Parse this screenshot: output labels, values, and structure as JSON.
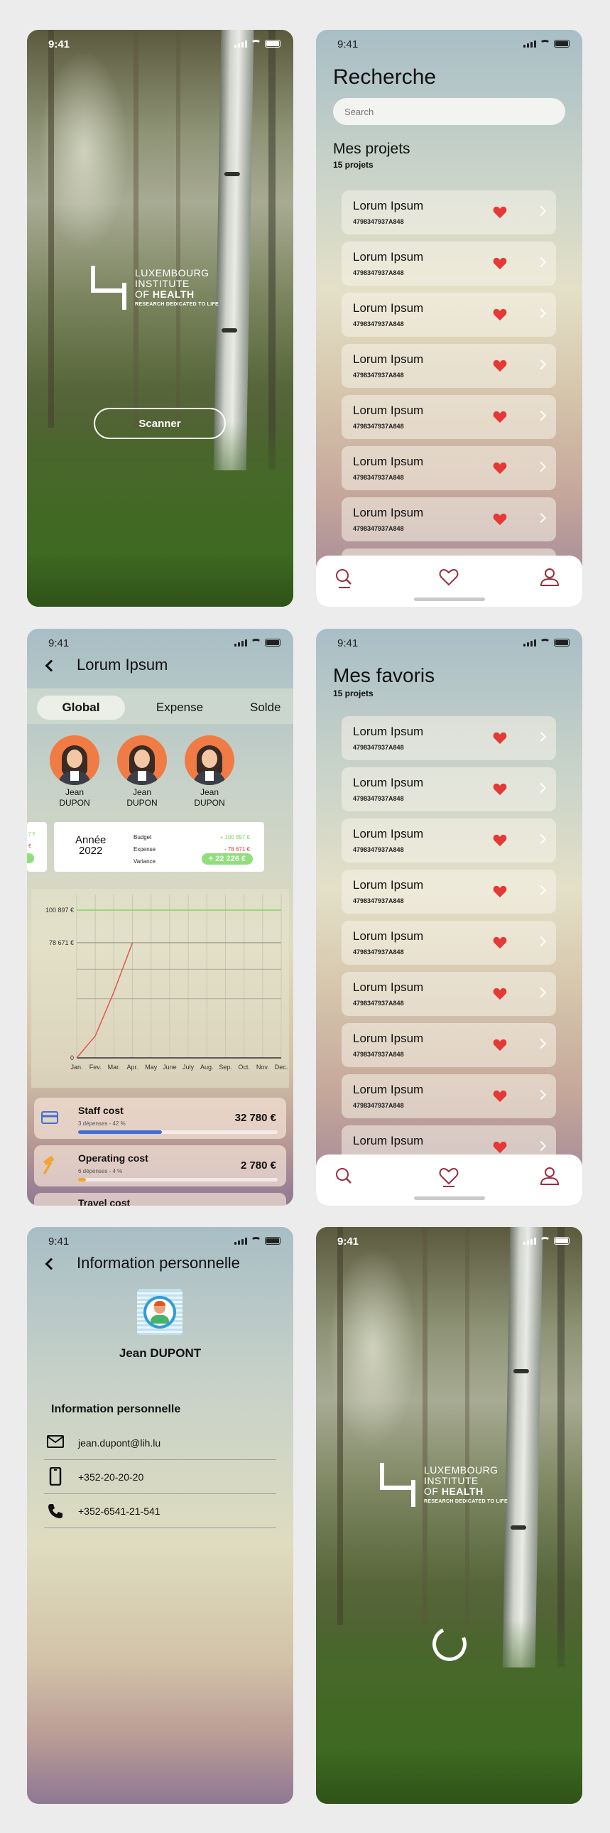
{
  "status_time": "9:41",
  "splash": {
    "logo_line1": "LUXEMBOURG",
    "logo_line2": "INSTITUTE",
    "logo_line3a": "OF ",
    "logo_line3b": "HEALTH",
    "logo_tagline": "RESEARCH DEDICATED TO LIFE",
    "scan_button": "Scanner"
  },
  "search_screen": {
    "title": "Recherche",
    "search_placeholder": "Search",
    "section_title": "Mes projets",
    "section_count": "15 projets",
    "projects": [
      {
        "name": "Lorum Ipsum",
        "code": "4798347937A848"
      },
      {
        "name": "Lorum Ipsum",
        "code": "4798347937A848"
      },
      {
        "name": "Lorum Ipsum",
        "code": "4798347937A848"
      },
      {
        "name": "Lorum Ipsum",
        "code": "4798347937A848"
      },
      {
        "name": "Lorum Ipsum",
        "code": "4798347937A848"
      },
      {
        "name": "Lorum Ipsum",
        "code": "4798347937A848"
      },
      {
        "name": "Lorum Ipsum",
        "code": "4798347937A848"
      }
    ]
  },
  "project_screen": {
    "title": "Lorum Ipsum",
    "tabs": [
      "Global",
      "Expense",
      "Solde"
    ],
    "people": [
      {
        "first": "Jean",
        "last": "DUPON"
      },
      {
        "first": "Jean",
        "last": "DUPON"
      },
      {
        "first": "Jean",
        "last": "DUPON"
      }
    ],
    "prev_card_partial": [
      "7 €",
      "€"
    ],
    "year_label": "Année",
    "year_value": "2022",
    "summary_labels": [
      "Budget",
      "Expense",
      "Variance"
    ],
    "summary_values": [
      "+ 100 897 €",
      "- 78 671 €",
      "+ 22 226 €"
    ],
    "chart_data": {
      "type": "line",
      "categories": [
        "Jan.",
        "Fev.",
        "Mar.",
        "Apr.",
        "May",
        "June",
        "July",
        "Aug.",
        "Sep.",
        "Oct.",
        "Nov.",
        "Dec."
      ],
      "series": [
        {
          "values": [
            0,
            15000,
            45000,
            78671
          ]
        }
      ],
      "reference_lines": [
        100897,
        78671
      ],
      "yticks": [
        "100 897 €",
        "78 671 €",
        "0"
      ],
      "ylim": [
        0,
        100897
      ],
      "colors": {
        "line": "#e0574f",
        "budget": "#7ed957"
      }
    },
    "costs": [
      {
        "title": "Staff cost",
        "sub": "3 dépenses - 42 %",
        "amount": "32 780 €",
        "progress": 0.42
      },
      {
        "title": "Operating cost",
        "sub": "6 dépenses - 4 %",
        "amount": "2 780 €",
        "progress": 0.04
      },
      {
        "title": "Travel cost",
        "sub": "",
        "amount": "",
        "progress": 0
      }
    ]
  },
  "favorites_screen": {
    "title": "Mes favoris",
    "count": "15 projets",
    "projects": [
      {
        "name": "Lorum Ipsum",
        "code": "4798347937A848"
      },
      {
        "name": "Lorum Ipsum",
        "code": "4798347937A848"
      },
      {
        "name": "Lorum Ipsum",
        "code": "4798347937A848"
      },
      {
        "name": "Lorum Ipsum",
        "code": "4798347937A848"
      },
      {
        "name": "Lorum Ipsum",
        "code": "4798347937A848"
      },
      {
        "name": "Lorum Ipsum",
        "code": "4798347937A848"
      },
      {
        "name": "Lorum Ipsum",
        "code": "4798347937A848"
      },
      {
        "name": "Lorum Ipsum",
        "code": "4798347937A848"
      },
      {
        "name": "Lorum Ipsum",
        "code": ""
      }
    ]
  },
  "profile_screen": {
    "title": "Information personnelle",
    "user_name": "Jean DUPONT",
    "section_title": "Information personnelle",
    "email": "jean.dupont@lih.lu",
    "mobile": "+352-20-20-20",
    "phone": "+352-6541-21-541"
  },
  "colors": {
    "accent_red": "#e53935",
    "progress_blue": "#3f6fd8",
    "variance_green": "#8fe07a",
    "avatar_orange": "#f07b44"
  },
  "icons": [
    "search-icon",
    "heart-icon",
    "user-icon",
    "chevron-right-icon",
    "back-icon",
    "mail-icon",
    "mobile-icon",
    "phone-icon",
    "card-icon",
    "hammer-icon"
  ]
}
